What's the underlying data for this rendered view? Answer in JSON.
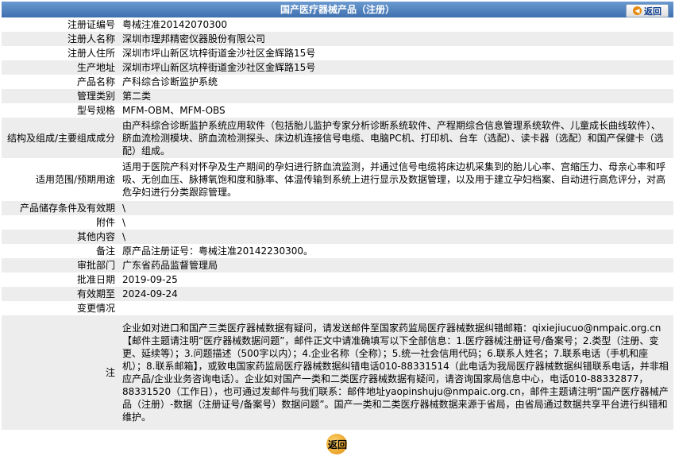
{
  "header": {
    "title": "国产医疗器械产品（注册）",
    "back_label": "返回"
  },
  "rows": [
    {
      "key": "注册证编号",
      "value": "粤械注准20142070300"
    },
    {
      "key": "注册人名称",
      "value": "深圳市理邦精密仪器股份有限公司"
    },
    {
      "key": "注册人住所",
      "value": "深圳市坪山新区坑梓街道金沙社区金辉路15号"
    },
    {
      "key": "生产地址",
      "value": "深圳市坪山新区坑梓街道金沙社区金辉路15号"
    },
    {
      "key": "产品名称",
      "value": "产科综合诊断监护系统"
    },
    {
      "key": "管理类别",
      "value": "第二类"
    },
    {
      "key": "型号规格",
      "value": "MFM-OBM、MFM-OBS"
    },
    {
      "key": "结构及组成/主要组成成分",
      "value": "由产科综合诊断监护系统应用软件（包括胎儿监护专家分析诊断系统软件、产程期综合信息管理系统软件、儿童成长曲线软件）、脐血流检测模块、脐血流检测探头、床边机连接信号电缆、电脑PC机、打印机、台车（选配）、读卡器（选配）和国产保健卡（选配）组成。"
    },
    {
      "key": "适用范围/预期用途",
      "value": "适用于医院产科对怀孕及生产期间的孕妇进行脐血流监测，并通过信号电缆将床边机采集到的胎儿心率、宫缩压力、母亲心率和呼吸、无创血压、脉搏氧饱和度和脉率、体温传输到系统上进行显示及数据管理，以及用于建立孕妇档案、自动进行高危评分，对高危孕妇进行分类跟踪管理。"
    },
    {
      "key": "产品储存条件及有效期",
      "value": "\\"
    },
    {
      "key": "附件",
      "value": "\\"
    },
    {
      "key": "其他内容",
      "value": "\\"
    },
    {
      "key": "备注",
      "value": "原产品注册证号：粤械注准20142230300。"
    },
    {
      "key": "审批部门",
      "value": "广东省药品监督管理局"
    },
    {
      "key": "批准日期",
      "value": "2019-09-25"
    },
    {
      "key": "有效期至",
      "value": "2024-09-24"
    },
    {
      "key": "变更情况",
      "value": ""
    },
    {
      "key": "注",
      "value": "企业如对进口和国产三类医疗器械数据有疑问，请发送邮件至国家药监局医疗器械数据纠错邮箱：qixiejiucuo@nmpaic.org.cn【邮件主题请注明“医疗器械数据问题”，邮件正文中请准确填写以下全部信息：1.医疗器械注册证号/备案号；2.类型（注册、变更、延续等）；3.问题描述（500字以内）；4.企业名称（全称）；5.统一社会信用代码；6.联系人姓名；7.联系电话（手机和座机）；8.联系邮箱】，或致电国家药监局医疗器械数据纠错电话010-88331514（此电话为我局医疗器械数据纠错联系电话，并非相应产品/企业业务咨询电话）。企业如对国产一类和二类医疗器械数据有疑问，请咨询国家局信息中心，电话010-88332877，88331520（工作日），也可通过发邮件与我们联系：邮件地址yaopinshuju@nmpaic.org.cn，邮件主题请注明“国产医疗器械产品（注册）-数据（注册证号/备案号）数据问题”。国产一类和二类医疗器械数据来源于省局，由省局通过数据共享平台进行纠错和维护。"
    }
  ],
  "footer": {
    "back_label": "返回"
  }
}
